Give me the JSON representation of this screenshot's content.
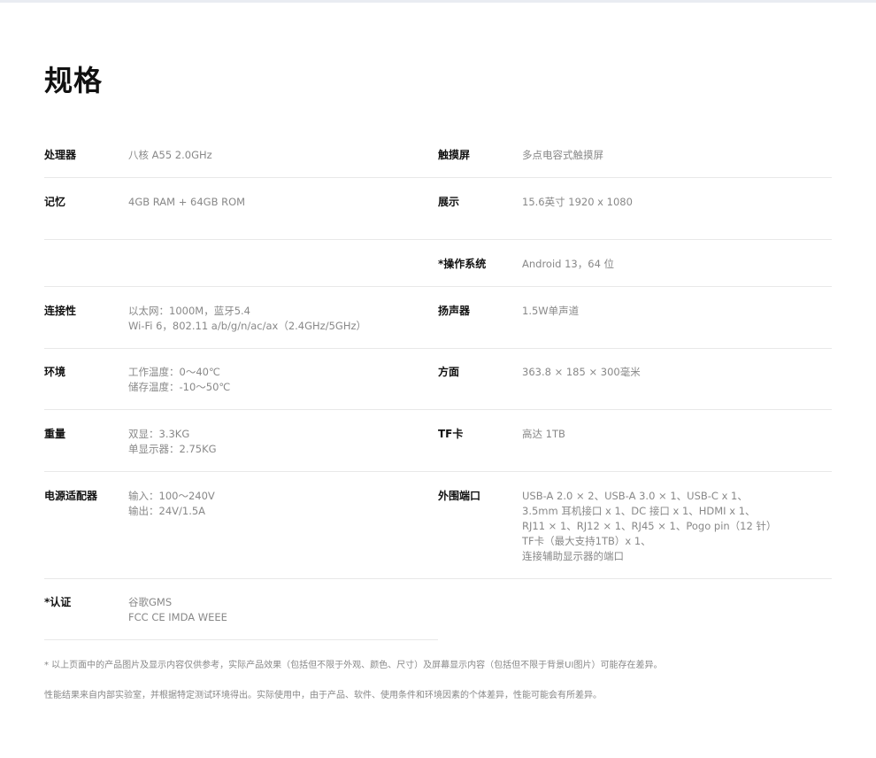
{
  "title": "规格",
  "specs": {
    "processor": {
      "label": "处理器",
      "lines": [
        "八核 A55 2.0GHz"
      ]
    },
    "touchscreen": {
      "label": "触摸屏",
      "lines": [
        "多点电容式触摸屏"
      ]
    },
    "memory": {
      "label": "记忆",
      "lines": [
        "4GB RAM + 64GB ROM"
      ]
    },
    "display": {
      "label": "展示",
      "lines": [
        "15.6英寸 1920 x 1080"
      ]
    },
    "os": {
      "label": "*操作系统",
      "lines": [
        "Android 13，64 位"
      ]
    },
    "connectivity": {
      "label": "连接性",
      "lines": [
        "以太网：1000M，蓝牙5.4",
        "Wi-Fi 6，802.11 a/b/g/n/ac/ax（2.4GHz/5GHz）"
      ]
    },
    "speaker": {
      "label": "扬声器",
      "lines": [
        "1.5W单声道"
      ]
    },
    "environment": {
      "label": "环境",
      "lines": [
        "工作温度：0～40℃",
        "储存温度：-10～50℃"
      ]
    },
    "dimensions": {
      "label": "方面",
      "lines": [
        "363.8 × 185 × 300毫米"
      ]
    },
    "weight": {
      "label": "重量",
      "lines": [
        "双显：3.3KG",
        "单显示器：2.75KG"
      ]
    },
    "tfcard": {
      "label": "TF卡",
      "lines": [
        "高达 1TB"
      ]
    },
    "power": {
      "label": "电源适配器",
      "lines": [
        "输入：100～240V",
        "输出：24V/1.5A"
      ]
    },
    "ports": {
      "label": "外围端口",
      "lines": [
        "USB-A 2.0 × 2、USB-A 3.0 × 1、USB-C x 1、",
        "3.5mm 耳机接口 x 1、DC 接口 x 1、HDMI x 1、",
        "RJ11 × 1、RJ12 × 1、RJ45 × 1、Pogo pin（12 针）",
        "TF卡（最大支持1TB）x 1、",
        "连接辅助显示器的端口"
      ]
    },
    "certification": {
      "label": "*认证",
      "lines": [
        "谷歌GMS",
        "FCC CE IMDA WEEE"
      ]
    }
  },
  "notes": [
    "* 以上页面中的产品图片及显示内容仅供参考，实际产品效果（包括但不限于外观、颜色、尺寸）及屏幕显示内容（包括但不限于背景UI图片）可能存在差异。",
    "性能结果来自内部实验室，并根据特定测试环境得出。实际使用中，由于产品、软件、使用条件和环境因素的个体差异，性能可能会有所差异。"
  ]
}
